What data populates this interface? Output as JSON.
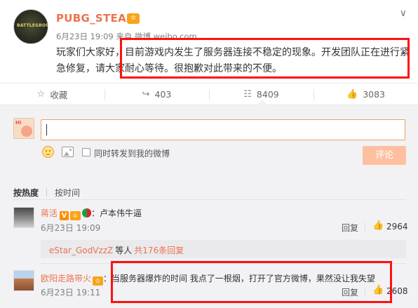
{
  "post": {
    "username": "PUBG_STEAM",
    "verified_badge": "♔",
    "avatar_text": "BATTLEGROUNDS",
    "date": "6月23日 19:09 来自 微博 weibo.com",
    "text": "玩家们大家好，目前游戏内发生了服务器连接不稳定的现象。开发团队正在进行紧急修复，请大家耐心等待。很抱歉对此带来的不便。",
    "menu_icon": "∨"
  },
  "actions": {
    "favorite": {
      "icon": "☆",
      "label": "收藏"
    },
    "repost": {
      "icon": "↪",
      "label": "403"
    },
    "comment": {
      "icon": "☷",
      "label": "8409"
    },
    "like": {
      "icon": "👍",
      "label": "3083"
    }
  },
  "composer": {
    "avatar_text": "Hi",
    "input_value": "",
    "repost_label": "同时转发到我的微博",
    "submit_label": "评论"
  },
  "sort_tabs": [
    "按热度",
    "按时间"
  ],
  "comments": [
    {
      "name": "蒋活",
      "text": "卢本伟牛逼",
      "date": "6月23日 19:09",
      "reply": "回复",
      "likes": "2964",
      "sub_reply": {
        "name": "eStar_GodVzzZ",
        "mid": "等人",
        "more": "共176条回复"
      }
    },
    {
      "name": "欧阳走路带火",
      "text": "当服务器爆炸的时间 我点了一根烟，打开了官方微博，果然没让我失望",
      "date": "6月23日 19:11",
      "reply": "回复",
      "likes": "2608"
    }
  ],
  "colors": {
    "accent": "#eb7350",
    "highlight_box": "#ff1010",
    "submit_disabled": "#ffc09f"
  }
}
